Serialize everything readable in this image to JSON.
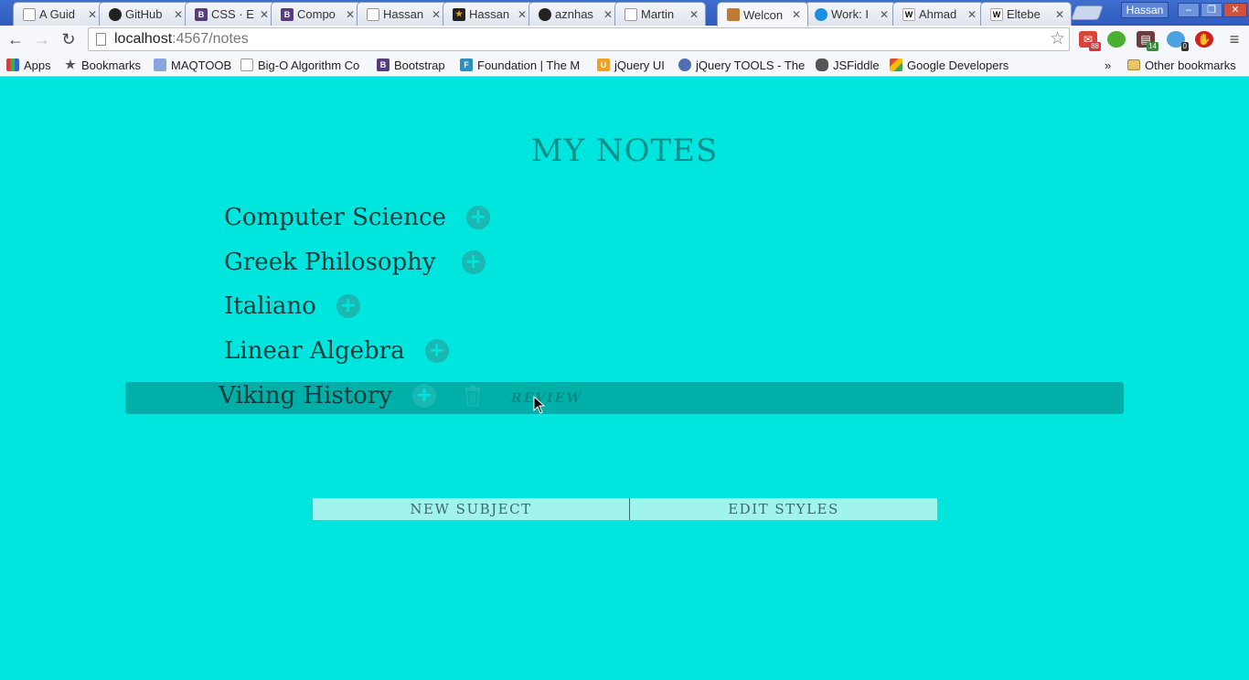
{
  "browser": {
    "tabs": [
      {
        "title": "A Guid",
        "icon": "document-icon"
      },
      {
        "title": "GitHub",
        "icon": "github-icon"
      },
      {
        "title": "CSS · E",
        "icon": "bootstrap-icon"
      },
      {
        "title": "Compo",
        "icon": "bootstrap-icon"
      },
      {
        "title": "Hassan",
        "icon": "document-icon"
      },
      {
        "title": "Hassan",
        "icon": "star-icon"
      },
      {
        "title": "aznhas",
        "icon": "github-icon"
      },
      {
        "title": "Martin",
        "icon": "document-icon"
      },
      {
        "title": "Welcon",
        "icon": "notes-icon",
        "active": true
      },
      {
        "title": "Work: I",
        "icon": "cloud-icon"
      },
      {
        "title": "Ahmad",
        "icon": "wikipedia-icon"
      },
      {
        "title": "Eltebe",
        "icon": "wikipedia-icon"
      }
    ],
    "profile_name": "Hassan",
    "url_host": "localhost",
    "url_path": ":4567/notes",
    "extension_badges": {
      "gmail": "88",
      "feed": "14",
      "ghost": "0"
    },
    "bookmarks": [
      {
        "label": "Apps",
        "icon": "apps-grid-icon"
      },
      {
        "label": "Bookmarks",
        "icon": "star-icon"
      },
      {
        "label": "MAQTOOB",
        "icon": "maqtoob-icon"
      },
      {
        "label": "Big-O Algorithm Co",
        "icon": "document-icon"
      },
      {
        "label": "Bootstrap",
        "icon": "bootstrap-icon"
      },
      {
        "label": "Foundation | The M",
        "icon": "foundation-icon"
      },
      {
        "label": "jQuery UI",
        "icon": "jquery-ui-icon"
      },
      {
        "label": "jQuery TOOLS - The",
        "icon": "globe-icon"
      },
      {
        "label": "JSFiddle",
        "icon": "jsfiddle-icon"
      },
      {
        "label": "Google Developers",
        "icon": "google-dev-icon"
      }
    ],
    "overflow_chevron": "»",
    "other_bookmarks": "Other bookmarks"
  },
  "page": {
    "title": "MY NOTES",
    "subjects": [
      {
        "name": "Computer Science"
      },
      {
        "name": "Greek Philosophy"
      },
      {
        "name": "Italiano"
      },
      {
        "name": "Linear Algebra"
      },
      {
        "name": "Viking History",
        "active": true
      }
    ],
    "plus_symbol": "+",
    "review_label": "REVIEW",
    "buttons": {
      "new_subject": "NEW SUBJECT",
      "edit_styles": "EDIT STYLES"
    }
  },
  "colors": {
    "page_bg": "#00e5dd",
    "accent": "#00b0a8",
    "title": "#0d8f8a"
  }
}
